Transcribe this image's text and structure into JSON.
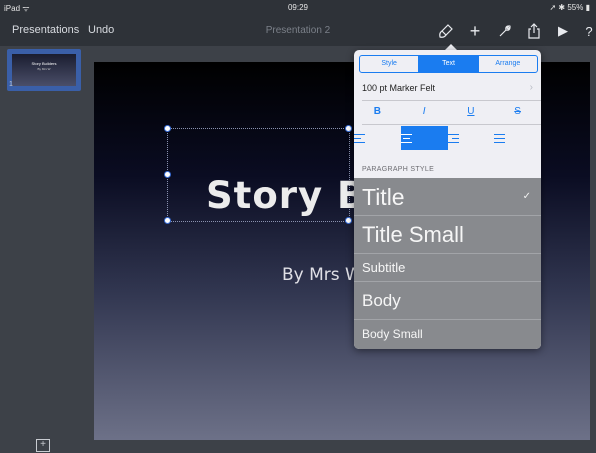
{
  "status_bar": {
    "left": "iPad ᯤ",
    "time": "09:29",
    "right": "➚ ✱ 55% ▮"
  },
  "toolbar": {
    "presentations_label": "Presentations",
    "undo_label": "Undo",
    "document_title": "Presentation 2",
    "icons": [
      "format-brush-icon",
      "add-icon",
      "wrench-icon",
      "share-icon",
      "play-icon",
      "help-icon"
    ],
    "add_glyph": "+",
    "play_glyph": "▶",
    "help_glyph": "?"
  },
  "navigator": {
    "thumb_title": "Story Builders",
    "thumb_subtitle": "By Mrs W",
    "slide_number": "1",
    "add_slide_glyph": "+"
  },
  "slide": {
    "title": "Story B",
    "subtitle": "By Mrs W"
  },
  "format_popover": {
    "tabs": [
      "Style",
      "Text",
      "Arrange"
    ],
    "active_tab": "Text",
    "font_label": "100 pt Marker Felt",
    "font_chevron": "›",
    "style_buttons": [
      "B",
      "I",
      "U",
      "S"
    ],
    "alignments": [
      "left",
      "center",
      "right",
      "justify"
    ],
    "active_alignment": "center",
    "paragraph_style_header": "PARAGRAPH STYLE",
    "paragraph_styles": [
      "Title",
      "Title Small",
      "Subtitle",
      "Body",
      "Body Small"
    ],
    "selected_style": "Title",
    "check_glyph": "✓"
  },
  "colors": {
    "accent": "#1a7cf0",
    "popover_bg": "#efeff4",
    "list_bg": "#888a8e"
  }
}
